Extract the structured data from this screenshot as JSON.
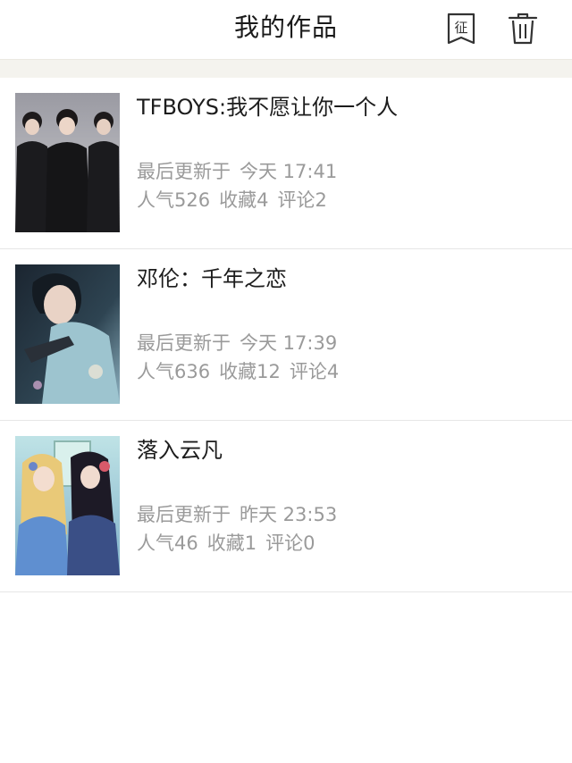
{
  "header": {
    "title": "我的作品",
    "contest_icon_char": "征"
  },
  "works": [
    {
      "title": "TFBOYS:我不愿让你一个人",
      "updated_prefix": "最后更新于",
      "updated_time": "今天 17:41",
      "views": "人气526",
      "favorites": "收藏4",
      "comments": "评论2"
    },
    {
      "title": "邓伦：千年之恋",
      "updated_prefix": "最后更新于",
      "updated_time": "今天 17:39",
      "views": "人气636",
      "favorites": "收藏12",
      "comments": "评论4"
    },
    {
      "title": "落入云凡",
      "updated_prefix": "最后更新于",
      "updated_time": "昨天 23:53",
      "views": "人气46",
      "favorites": "收藏1",
      "comments": "评论0"
    }
  ]
}
